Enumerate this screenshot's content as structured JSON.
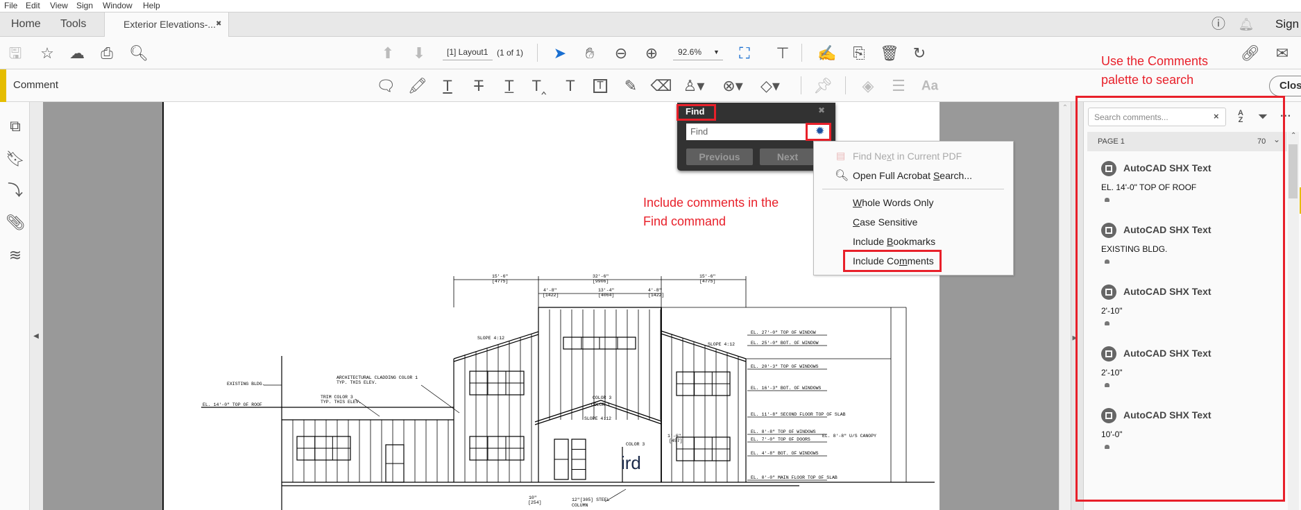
{
  "menu": [
    "File",
    "Edit",
    "View",
    "Sign",
    "Window",
    "Help"
  ],
  "tabs": {
    "home": "Home",
    "tools": "Tools",
    "document": "Exterior Elevations-...",
    "close": "✖"
  },
  "header": {
    "sign_in": "Sign"
  },
  "toolbar": {
    "page_label": "[1] Layout1",
    "page_count": "(1 of 1)",
    "zoom": "92.6%"
  },
  "comment_bar": {
    "title": "Comment",
    "close": "Close",
    "font_tool": "Aa"
  },
  "find": {
    "title": "Find",
    "placeholder": "Find",
    "previous": "Previous",
    "next": "Next",
    "close": "✖"
  },
  "find_menu": [
    {
      "pre": "Find Ne",
      "key": "x",
      "post": "t in Current PDF",
      "disabled": true
    },
    {
      "pre": "Open Full Acrobat ",
      "key": "S",
      "post": "earch..."
    },
    {
      "pre": "",
      "key": "W",
      "post": "hole Words Only"
    },
    {
      "pre": "",
      "key": "C",
      "post": "ase Sensitive"
    },
    {
      "pre": "Include ",
      "key": "B",
      "post": "ookmarks"
    },
    {
      "pre": "Include Co",
      "key": "m",
      "post": "ments"
    }
  ],
  "annotations": {
    "find_callout": [
      "Include comments in the",
      "Find command"
    ],
    "panel_callout": [
      "Use the Comments",
      "palette to search"
    ],
    "color": "#e8202a"
  },
  "comments_panel": {
    "search_placeholder": "Search comments...",
    "page_label": "PAGE 1",
    "count": "70",
    "items": [
      {
        "author": "AutoCAD SHX Text",
        "text": "EL. 14'-0\" TOP OF ROOF"
      },
      {
        "author": "AutoCAD SHX Text",
        "text": "EXISTING BLDG."
      },
      {
        "author": "AutoCAD SHX Text",
        "text": "2'-10\""
      },
      {
        "author": "AutoCAD SHX Text",
        "text": "2'-10\""
      },
      {
        "author": "AutoCAD SHX Text",
        "text": "10'-0\""
      }
    ]
  },
  "drawing": {
    "labels": [
      "EXISTING BLDG.",
      "ARCHITECTURAL CLADDING COLOR 1",
      "TYP. THIS ELEV.",
      "TRIM COLOR 3",
      "TYP. THIS ELEV.",
      "EL. 14'-0\" TOP OF ROOF",
      "SLOPE 4:12",
      "SLOPE 4:12",
      "SLOPE 4:12",
      "15'-6\"",
      "[4775]",
      "32'-6\"",
      "[9906]",
      "15'-6\"",
      "[4775]",
      "4'-8\"",
      "[1422]",
      "13'-4\"",
      "[4064]",
      "4'-8\"",
      "[1422]",
      "EL. 27'-0\" TOP OF WINDOW",
      "EL. 25'-0\" BOT. OF WINDOW",
      "EL. 20'-3\" TOP OF WINDOWS",
      "EL. 16'-3\" BOT. OF WINDOWS",
      "EL. 11'-8\" SECOND FLOOR TOP OF SLAB",
      "EL. 8'-8\" TOP OF WINDOWS",
      "EL. 8'-8\" U/S CANOPY",
      "EL. 7'-0\" TOP OF DOORS",
      "EL. 4'-8\" BOT. OF WINDOWS",
      "EL. 0'-0\" MAIN FLOOR TOP OF SLAB",
      "COLOR 3",
      "COLOR 1",
      "COLOR 3",
      "12\"[305] STEEL",
      "COLUMN",
      "10\"",
      "[254]",
      "1'-6\"",
      "[457]"
    ],
    "artifact": "ird"
  }
}
